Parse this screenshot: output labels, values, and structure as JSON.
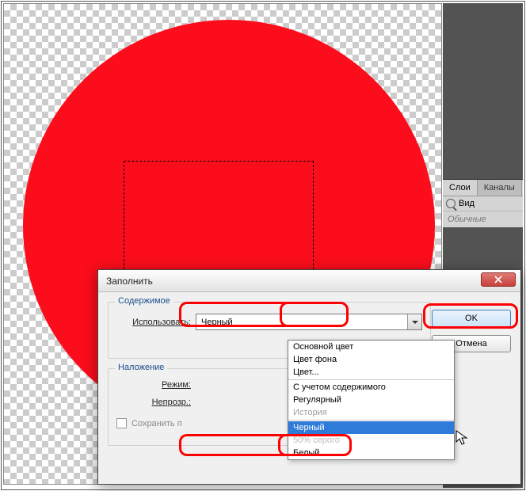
{
  "panel": {
    "tabs": {
      "layers": "Слои",
      "channels": "Каналы"
    },
    "search_placeholder": "Вид",
    "mode": "Обычные"
  },
  "dialog": {
    "title": "Заполнить",
    "group_content": "Содержимое",
    "use_label": "Использовать:",
    "use_value": "Черный",
    "group_blend": "Наложение",
    "mode_label": "Режим:",
    "opacity_label": "Непрозр.:",
    "preserve_label": "Сохранить п",
    "ok": "OK",
    "cancel": "Отмена"
  },
  "dropdown": {
    "items": [
      {
        "label": "Основной цвет",
        "state": "normal"
      },
      {
        "label": "Цвет фона",
        "state": "normal"
      },
      {
        "label": "Цвет...",
        "state": "normal"
      },
      {
        "sep": true
      },
      {
        "label": "С учетом содержимого",
        "state": "normal"
      },
      {
        "label": "Регулярный",
        "state": "normal"
      },
      {
        "label": "История",
        "state": "disabled"
      },
      {
        "sep": true
      },
      {
        "label": "Черный",
        "state": "selected"
      },
      {
        "label": "50% серого",
        "state": "covered"
      },
      {
        "label": "Белый",
        "state": "normal"
      }
    ]
  }
}
